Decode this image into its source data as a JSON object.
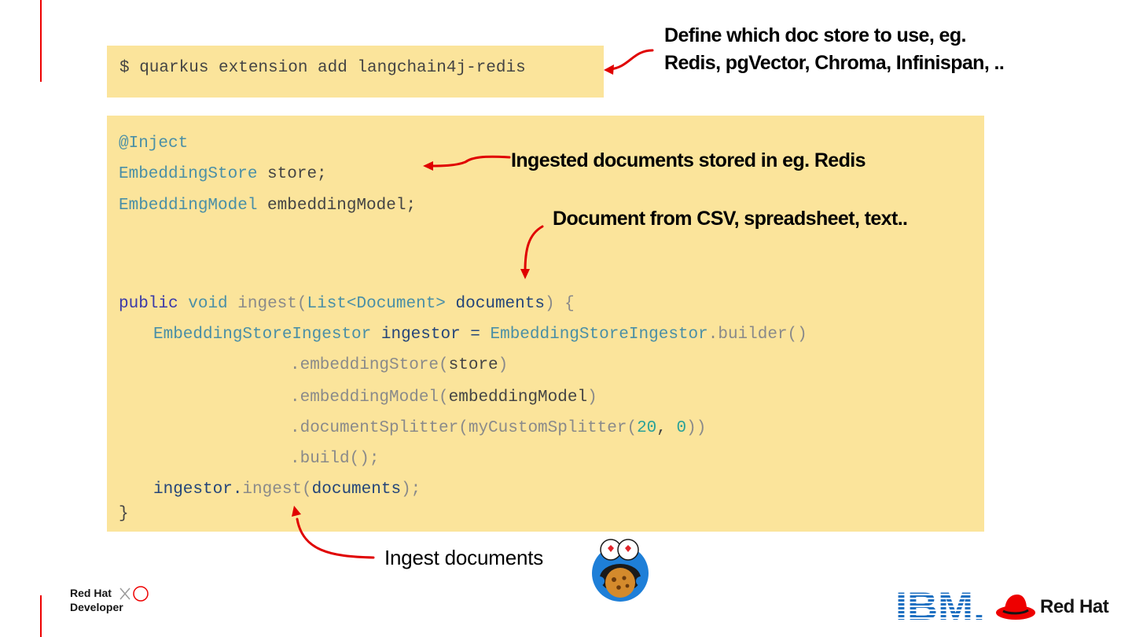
{
  "command": "$ quarkus extension add langchain4j-redis",
  "code": {
    "l1": "@Inject",
    "l2_type": "EmbeddingStore",
    "l2_rest": " store;",
    "l3_type": "EmbeddingModel",
    "l3_rest": " embeddingModel;",
    "l4_kw": "public",
    "l4_void": "void",
    "l4_fn": "ingest(",
    "l4_type": "List<Document>",
    "l4_param": "documents",
    "l4_end": ") {",
    "l5_type": "EmbeddingStoreIngestor",
    "l5_var": "ingestor = ",
    "l5_type2": "EmbeddingStoreIngestor",
    "l5_call": ".builder()",
    "l6_call": ".embeddingStore(",
    "l6_arg": "store",
    "l6_end": ")",
    "l7_call": ".embeddingModel(",
    "l7_arg": "embeddingModel",
    "l7_end": ")",
    "l8_call": ".documentSplitter(myCustomSplitter(",
    "l8_n1": "20",
    "l8_sep": ", ",
    "l8_n2": "0",
    "l8_end": "))",
    "l9": ".build();",
    "l10_var": "ingestor.",
    "l10_fn": "ingest(",
    "l10_arg": "documents",
    "l10_end": ");",
    "l11": "}"
  },
  "annotations": {
    "doc_store_line1": "Define which doc store to use, eg.",
    "doc_store_line2": "Redis, pgVector, Chroma, Infinispan, ..",
    "stored": "Ingested documents stored in eg. Redis",
    "document_from": "Document from CSV, spreadsheet, text..",
    "ingest": "Ingest documents"
  },
  "logos": {
    "developer_line1": "Red Hat",
    "developer_line2": "Developer",
    "ibm": "IBM.",
    "redhat": "Red Hat"
  },
  "colors": {
    "accent": "#ee0000",
    "code_bg": "#fbe49b",
    "ibm_blue": "#1f70c1"
  }
}
